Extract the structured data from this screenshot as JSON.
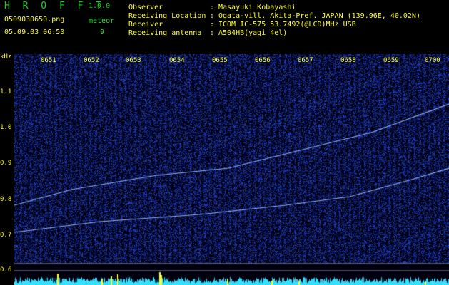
{
  "header": {
    "title": "H R O F F T",
    "version": "1.0.0",
    "filename": "0509030650.png",
    "mode": "meteor",
    "datetime": "05.09.03 06:50",
    "count": "9"
  },
  "info": [
    {
      "label": "Observer",
      "value": "Masayuki Kobayashi"
    },
    {
      "label": "Receiving Location",
      "value": "Ogata-vill. Akita-Pref. JAPAN (139.96E, 40.02N)"
    },
    {
      "label": "Receiver",
      "value": "ICOM IC-575 53.7492(@LCD)MHz USB"
    },
    {
      "label": "Receiving antenna",
      "value": "A504HB(yagi 4el)"
    }
  ],
  "axis": {
    "unit": "kHz",
    "y_ticks": [
      "1.1",
      "1.0",
      "0.9",
      "0.8",
      "0.7",
      "0.6"
    ],
    "x_ticks": [
      "0651",
      "0652",
      "0653",
      "0654",
      "0655",
      "0656",
      "0657",
      "0658",
      "0659",
      "0700"
    ]
  },
  "colors": {
    "background": "#000010",
    "noise": "#1a3aff",
    "trace": "#8fb0ff",
    "power": "#33e0ff",
    "spike": "#ffff33"
  }
}
